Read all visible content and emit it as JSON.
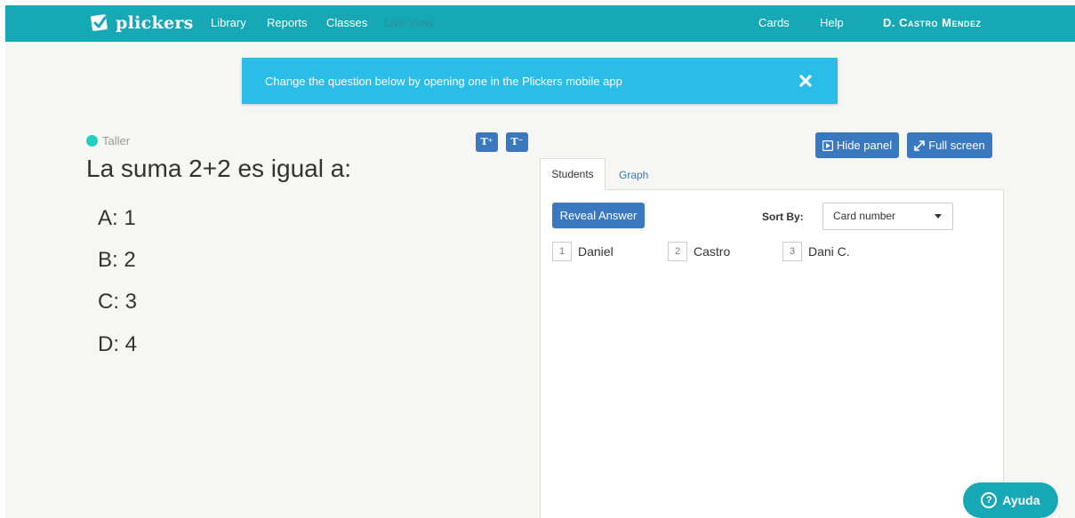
{
  "nav": {
    "brand": "plickers",
    "links": [
      "Library",
      "Reports",
      "Classes",
      "Live View"
    ],
    "right_links": [
      "Cards",
      "Help"
    ],
    "user": "D. Castro Mendez"
  },
  "alert": {
    "text": "Change the question below by opening one in the Plickers mobile app",
    "close_icon": "close-icon"
  },
  "question": {
    "folder": "Taller",
    "text": "La suma 2+2 es igual a:",
    "choices": [
      "A: 1",
      "B: 2",
      "C: 3",
      "D: 4"
    ],
    "font_buttons": [
      "T⁺",
      "T⁻"
    ]
  },
  "panel": {
    "hide_label": "Hide panel",
    "fullscreen_label": "Full screen",
    "tabs": [
      "Students",
      "Graph"
    ],
    "reveal_label": "Reveal Answer",
    "sort_by_label": "Sort By:",
    "sort_value": "Card number",
    "students": [
      {
        "card": "1",
        "name": "Daniel"
      },
      {
        "card": "2",
        "name": "Castro"
      },
      {
        "card": "3",
        "name": "Dani C."
      }
    ]
  },
  "help_button": "Ayuda",
  "colors": {
    "navbar": "#17a8b5",
    "alert": "#29bde8",
    "button": "#3a78c0",
    "folder_dot": "#23d0c0"
  }
}
